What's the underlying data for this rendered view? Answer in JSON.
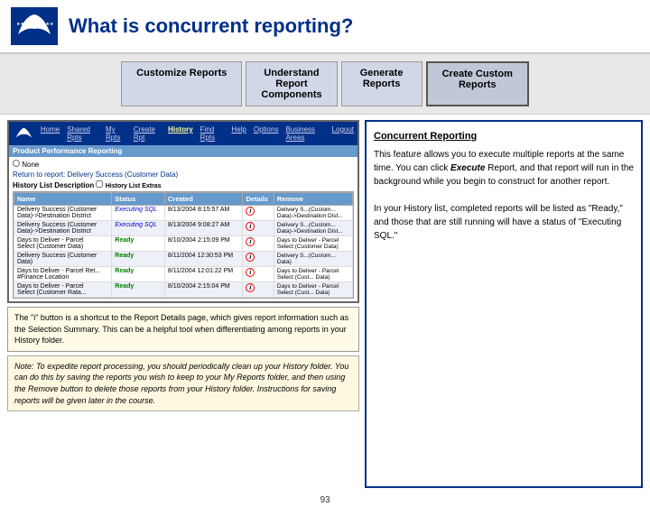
{
  "header": {
    "title": "What is concurrent reporting?"
  },
  "steps": [
    {
      "label": "Customize\nReports",
      "active": false
    },
    {
      "label": "Understand\nReport\nComponents",
      "active": false
    },
    {
      "label": "Generate\nReports",
      "active": false
    },
    {
      "label": "Create Custom\nReports",
      "active": true
    }
  ],
  "app": {
    "nav_links": [
      "Home",
      "Shared Rpts",
      "My Rpts",
      "Create Rpt",
      "History",
      "Find Rpts",
      "Help",
      "Options",
      "Business Areas",
      "Logout"
    ],
    "sub_nav": "Product Performance Reporting",
    "breadcrumb": "Return to report: Delivery Success (Customer Data)",
    "none_label": "None",
    "history_label": "History List Description",
    "table_headers": [
      "Name",
      "Status",
      "Created",
      "Details",
      "Remove"
    ],
    "table_rows": [
      {
        "name": "Delivery Success (Customer Data)->Destination District",
        "status": "Executing SQL",
        "created": "8/13/2004 8:15:57 AM",
        "details": "i",
        "remove": "Delivery Success (Customer Data)->Destination District"
      },
      {
        "name": "Delivery Success (Customer Data)->Destination District",
        "status": "Executing SQL",
        "created": "8/13/2004 9:08:27 AM",
        "details": "i",
        "remove": "Delivery Success (Customer Data)->Destination District"
      },
      {
        "name": "Days to Deliver - Parcel Select (Customer Data)",
        "status": "Ready",
        "created": "8/10/2004 2:15:09 PM",
        "details": "i",
        "remove": "Days to Deliver - Parcel Select (Customer Data)"
      },
      {
        "name": "Delivery Success (Customer Data)",
        "status": "Ready",
        "created": "8/11/2004 12:30:53 PM",
        "details": "i",
        "remove": "Delivery Success (Customer Data)"
      },
      {
        "name": "Days to Deliver - Parcel Select (Customer Data) #Finance Location",
        "status": "Ready",
        "created": "8/11/2004 12:01:22 PM",
        "details": "i",
        "remove": "Days to Deliver - Parcel Select (Customer Data)"
      },
      {
        "name": "Days to Deliver - Parcel Select (Customer Rata...",
        "status": "Ready",
        "created": "8/10/2004 2:15:04 PM",
        "details": "i",
        "remove": "Days to Deliver - Parcel Select (Customer Data)"
      }
    ]
  },
  "callout": {
    "text": "The \"i\" button is a shortcut to the Report Details page, which gives report information such as the Selection Summary. This can be a helpful tool when differentiating among reports in your History folder."
  },
  "note": {
    "text": "Note:  To expedite report processing, you should periodically clean up your History folder.  You can do this by saving the reports you wish to keep to your My Reports folder, and then using the Remove button to delete those reports from your History folder.  Instructions for saving reports will be given later in the course."
  },
  "concurrent": {
    "title": "Concurrent Reporting",
    "body": "This feature allows you to execute multiple reports at the same time.  You can click Execute Report, and that report will run in the background while you begin to construct for another report.\n\nIn your History list, completed reports will be listed as \"Ready,\" and those that are still running will have a status of \"Executing SQL.\""
  },
  "page_number": "93"
}
